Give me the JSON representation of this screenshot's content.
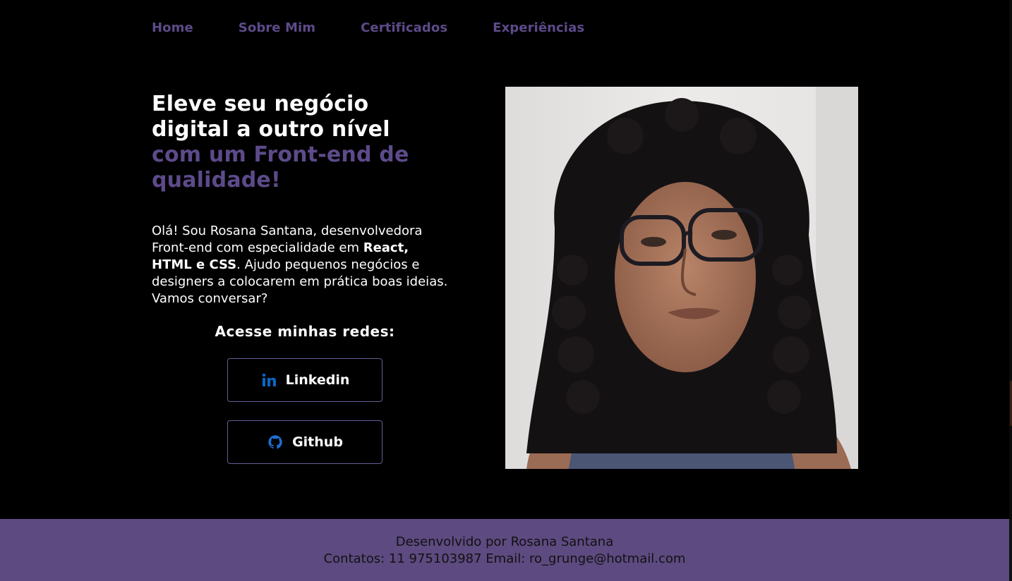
{
  "nav": {
    "items": [
      {
        "label": "Home"
      },
      {
        "label": "Sobre Mim"
      },
      {
        "label": "Certificados"
      },
      {
        "label": "Experiências"
      }
    ]
  },
  "hero": {
    "headline_line1": "Eleve seu negócio",
    "headline_line2": "digital a outro nível",
    "headline_line3": "com um Front-end de",
    "headline_line4": "qualidade!",
    "intro_part1": "Olá! Sou Rosana Santana, desenvolvedora Front-end com especialidade em ",
    "intro_bold": "React, HTML e CSS",
    "intro_part2": ". Ajudo pequenos negócios e designers a colocarem em prática boas ideias. Vamos conversar?"
  },
  "social": {
    "title": "Acesse minhas redes:",
    "linkedin_label": "Linkedin",
    "linkedin_icon": "linkedin-icon",
    "github_label": "Github",
    "github_icon": "github-icon"
  },
  "footer": {
    "line1": "Desenvolvido por Rosana Santana",
    "line2": "Contatos: 11 975103987 Email: ro_grunge@hotmail.com"
  },
  "colors": {
    "background": "#000000",
    "accent_purple": "#5d4a8a",
    "footer_bg": "#5d4a80",
    "icon_blue": "#0a66c2"
  }
}
